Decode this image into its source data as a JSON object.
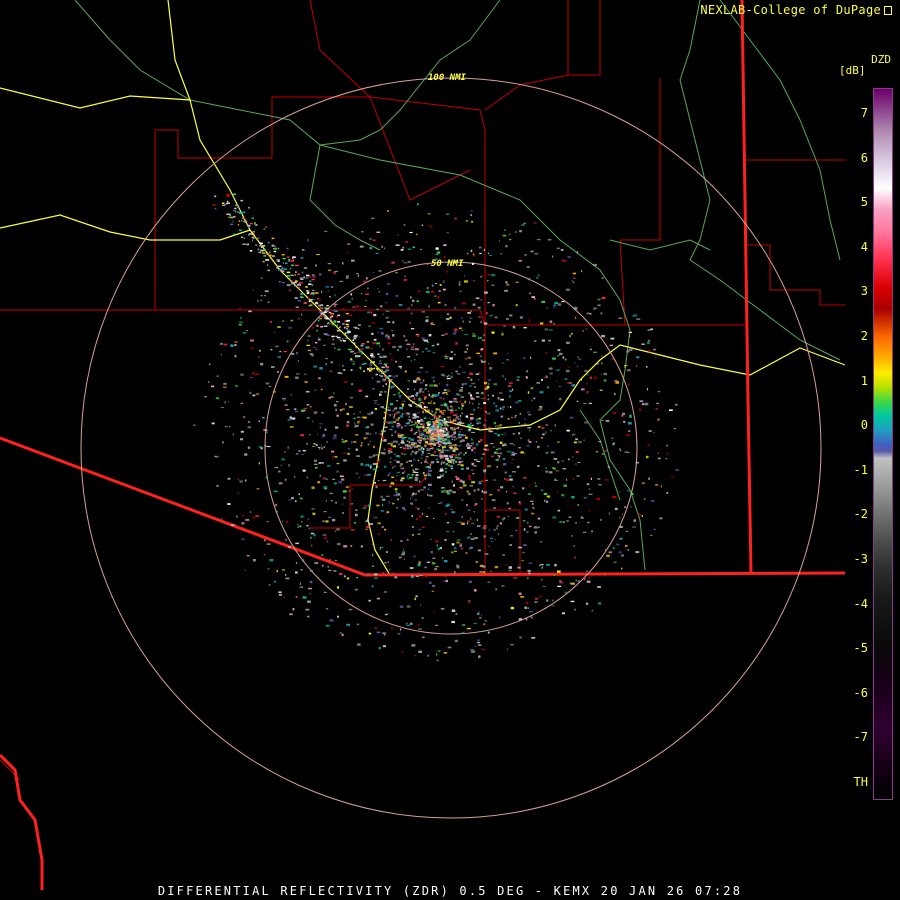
{
  "credit": "NEXLAB-College of DuPage",
  "caption": "DIFFERENTIAL REFLECTIVITY (ZDR) 0.5 DEG - KEMX 20 JAN 26 07:28",
  "legend": {
    "title": "DZD",
    "unit": "[dB]",
    "ticks": [
      "7",
      "6",
      "5",
      "4",
      "3",
      "2",
      "1",
      "0",
      "-1",
      "-2",
      "-3",
      "-4",
      "-5",
      "-6",
      "-7",
      "TH"
    ]
  },
  "range_rings": [
    "100 NMI",
    "50 NMI"
  ],
  "colors": {
    "state_border": "#ff2020",
    "county_line": "#c00000",
    "highway": "#ffff40",
    "river": "#66bb66",
    "range_ring": "#d8a098",
    "label": "#ffff40"
  },
  "icons": {
    "credit": "external-link-icon"
  }
}
